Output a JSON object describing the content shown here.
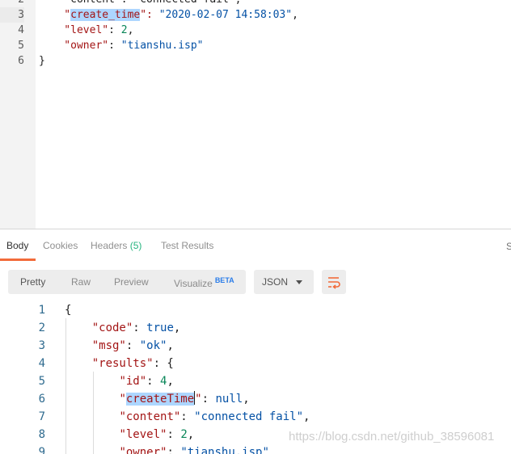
{
  "request_editor": {
    "lines": [
      {
        "num": "2",
        "parts": [
          {
            "t": "    \"content\": \"connected fail\",",
            "c": "p"
          }
        ]
      },
      {
        "num": "3",
        "active": true,
        "parts": [
          {
            "t": "    \"",
            "c": "k"
          },
          {
            "t": "create_time",
            "c": "k hl"
          },
          {
            "t": "\": ",
            "c": "k"
          },
          {
            "t": "\"2020-02-07 14:58:03\"",
            "c": "s"
          },
          {
            "t": ",",
            "c": "p"
          }
        ]
      },
      {
        "num": "4",
        "parts": [
          {
            "t": "    \"level\"",
            "c": "k"
          },
          {
            "t": ": ",
            "c": "p"
          },
          {
            "t": "2",
            "c": "n"
          },
          {
            "t": ",",
            "c": "p"
          }
        ]
      },
      {
        "num": "5",
        "parts": [
          {
            "t": "    \"owner\"",
            "c": "k"
          },
          {
            "t": ": ",
            "c": "p"
          },
          {
            "t": "\"tianshu.isp\"",
            "c": "s"
          }
        ]
      },
      {
        "num": "6",
        "parts": [
          {
            "t": "}",
            "c": "p"
          }
        ]
      }
    ]
  },
  "response": {
    "tabs": [
      {
        "label": "Body",
        "active": true
      },
      {
        "label": "Cookies"
      },
      {
        "label": "Headers",
        "count": "(5)"
      },
      {
        "label": "Test Results"
      }
    ],
    "edge_text": "S",
    "view_modes": [
      "Pretty",
      "Raw",
      "Preview",
      "Visualize"
    ],
    "beta_label": "BETA",
    "format": "JSON",
    "wrap_icon": "wrap-lines-icon",
    "accent_color": "#f26b3a",
    "lines": [
      {
        "num": "1",
        "parts": [
          {
            "t": "{",
            "c": "p"
          }
        ]
      },
      {
        "num": "2",
        "parts": [
          {
            "t": "    ",
            "c": "p"
          },
          {
            "t": "\"code\"",
            "c": "k"
          },
          {
            "t": ": ",
            "c": "p"
          },
          {
            "t": "true",
            "c": "s"
          },
          {
            "t": ",",
            "c": "p"
          }
        ]
      },
      {
        "num": "3",
        "parts": [
          {
            "t": "    ",
            "c": "p"
          },
          {
            "t": "\"msg\"",
            "c": "k"
          },
          {
            "t": ": ",
            "c": "p"
          },
          {
            "t": "\"ok\"",
            "c": "s"
          },
          {
            "t": ",",
            "c": "p"
          }
        ]
      },
      {
        "num": "4",
        "parts": [
          {
            "t": "    ",
            "c": "p"
          },
          {
            "t": "\"results\"",
            "c": "k"
          },
          {
            "t": ": {",
            "c": "p"
          }
        ]
      },
      {
        "num": "5",
        "parts": [
          {
            "t": "        ",
            "c": "p"
          },
          {
            "t": "\"id\"",
            "c": "k"
          },
          {
            "t": ": ",
            "c": "p"
          },
          {
            "t": "4",
            "c": "n"
          },
          {
            "t": ",",
            "c": "p"
          }
        ]
      },
      {
        "num": "6",
        "parts": [
          {
            "t": "        ",
            "c": "p"
          },
          {
            "t": "\"",
            "c": "k"
          },
          {
            "t": "createTime",
            "c": "k hl"
          },
          {
            "cursor": true
          },
          {
            "t": "\"",
            "c": "k"
          },
          {
            "t": ": ",
            "c": "p"
          },
          {
            "t": "null",
            "c": "s"
          },
          {
            "t": ",",
            "c": "p"
          }
        ]
      },
      {
        "num": "7",
        "parts": [
          {
            "t": "        ",
            "c": "p"
          },
          {
            "t": "\"content\"",
            "c": "k"
          },
          {
            "t": ": ",
            "c": "p"
          },
          {
            "t": "\"connected fail\"",
            "c": "s"
          },
          {
            "t": ",",
            "c": "p"
          }
        ]
      },
      {
        "num": "8",
        "parts": [
          {
            "t": "        ",
            "c": "p"
          },
          {
            "t": "\"level\"",
            "c": "k"
          },
          {
            "t": ": ",
            "c": "p"
          },
          {
            "t": "2",
            "c": "n"
          },
          {
            "t": ",",
            "c": "p"
          }
        ]
      },
      {
        "num": "9",
        "parts": [
          {
            "t": "        ",
            "c": "p"
          },
          {
            "t": "\"owner\"",
            "c": "k"
          },
          {
            "t": ": ",
            "c": "p"
          },
          {
            "t": "\"tianshu.isp\"",
            "c": "s"
          }
        ]
      }
    ]
  },
  "watermark": "https://blog.csdn.net/github_38596081"
}
